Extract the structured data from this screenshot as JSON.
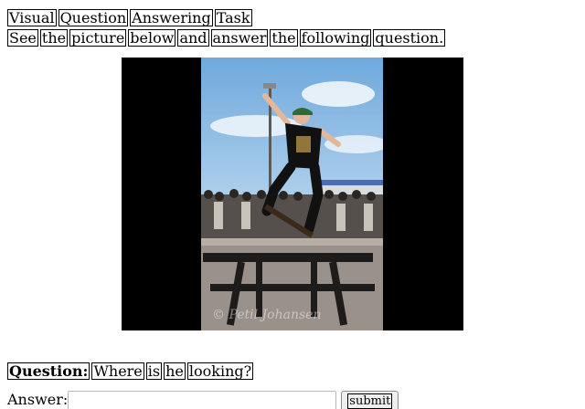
{
  "task": {
    "title_words": [
      "Visual",
      "Question",
      "Answering",
      "Task"
    ],
    "instruction_words": [
      "See",
      "the",
      "picture",
      "below",
      "and",
      "answer",
      "the",
      "following",
      "question."
    ]
  },
  "image": {
    "watermark": "© Petil Johansen"
  },
  "question": {
    "label": "Question:",
    "words": [
      "Where",
      "is",
      "he",
      "looking?"
    ]
  },
  "answer": {
    "label": "Answer:",
    "value": "",
    "placeholder": ""
  },
  "submit": {
    "label": "submit"
  }
}
